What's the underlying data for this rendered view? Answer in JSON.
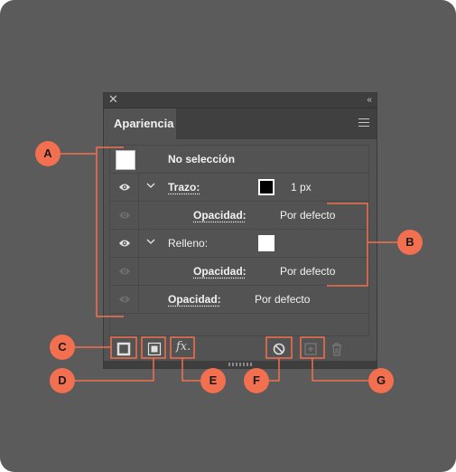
{
  "panel": {
    "tab_label": "Apariencia",
    "close_glyph": "✕",
    "collapse_glyph": "‹‹"
  },
  "rows": {
    "selection": {
      "label": "No selección"
    },
    "stroke": {
      "label": "Trazo:",
      "weight": "1 px"
    },
    "stroke_opacity": {
      "label": "Opacidad:",
      "value": "Por defecto"
    },
    "fill": {
      "label": "Relleno:"
    },
    "fill_opacity": {
      "label": "Opacidad:",
      "value": "Por defecto"
    },
    "object_opacity": {
      "label": "Opacidad:",
      "value": "Por defecto"
    }
  },
  "toolbar": {
    "add_stroke_icon": "add-new-stroke-icon",
    "add_fill_icon": "add-new-fill-icon",
    "fx_label": "fx.",
    "clear_icon": "clear-appearance-icon",
    "duplicate_icon": "duplicate-item-icon",
    "delete_icon": "trash-icon"
  },
  "callouts": {
    "A": "A",
    "B": "B",
    "C": "C",
    "D": "D",
    "E": "E",
    "F": "F",
    "G": "G"
  },
  "colors": {
    "callout": "#f26f4f",
    "panel": "#535353",
    "background": "#5b5b5b"
  }
}
